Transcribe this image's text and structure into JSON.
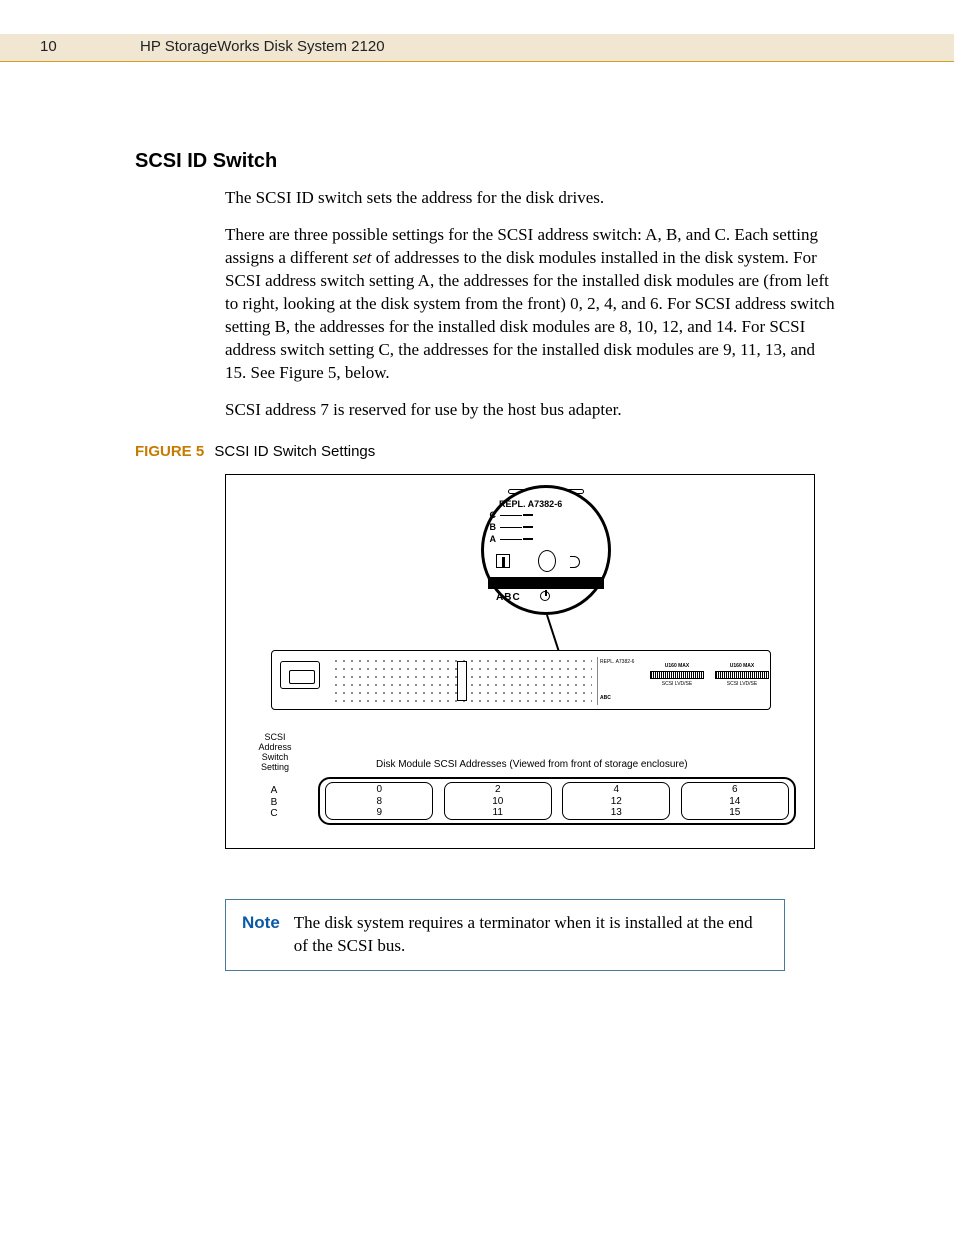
{
  "header": {
    "page_number": "10",
    "doc_title": "HP StorageWorks Disk System 2120"
  },
  "section": {
    "heading": "SCSI ID Switch",
    "p1": "The SCSI ID switch sets the address for the disk drives.",
    "p2_a": "There are three possible settings for the SCSI address switch: A, B, and C. Each setting assigns a different ",
    "p2_em": "set",
    "p2_b": " of addresses to the disk modules installed in the disk system. For SCSI address switch setting A, the addresses for the installed disk modules are (from left to right, looking at the disk system from the front) 0, 2, 4, and 6. For SCSI address switch setting B, the addresses for the installed disk modules are 8, 10, 12, and 14. For SCSI address switch setting C, the addresses for the installed disk modules are 9, 11, 13, and 15. See Figure 5, below.",
    "p3": "SCSI address 7 is reserved for use by the host bus adapter."
  },
  "figure": {
    "label": "FIGURE 5",
    "title": "SCSI ID Switch Settings",
    "zoom": {
      "repl": "REPL. A7382-6",
      "c": "C",
      "b": "B",
      "a": "A",
      "abc": "ABC"
    },
    "device": {
      "repl_small": "REPL. A7382-6",
      "abc_small": "ABC",
      "port_top": "U160 MAX",
      "port_bottom": "SCSI    LVD/SE"
    },
    "address": {
      "left_heading": "SCSI\nAddress\nSwitch\nSetting",
      "caption": "Disk Module SCSI Addresses (Viewed from front of storage enclosure)",
      "rows": {
        "a": "A",
        "b": "B",
        "c": "C"
      },
      "cols": [
        {
          "a": "0",
          "b": "8",
          "c": "9"
        },
        {
          "a": "2",
          "b": "10",
          "c": "11"
        },
        {
          "a": "4",
          "b": "12",
          "c": "13"
        },
        {
          "a": "6",
          "b": "14",
          "c": "15"
        }
      ]
    }
  },
  "note": {
    "label": "Note",
    "text": "The disk system requires a terminator when it is installed at the end of the SCSI bus."
  }
}
